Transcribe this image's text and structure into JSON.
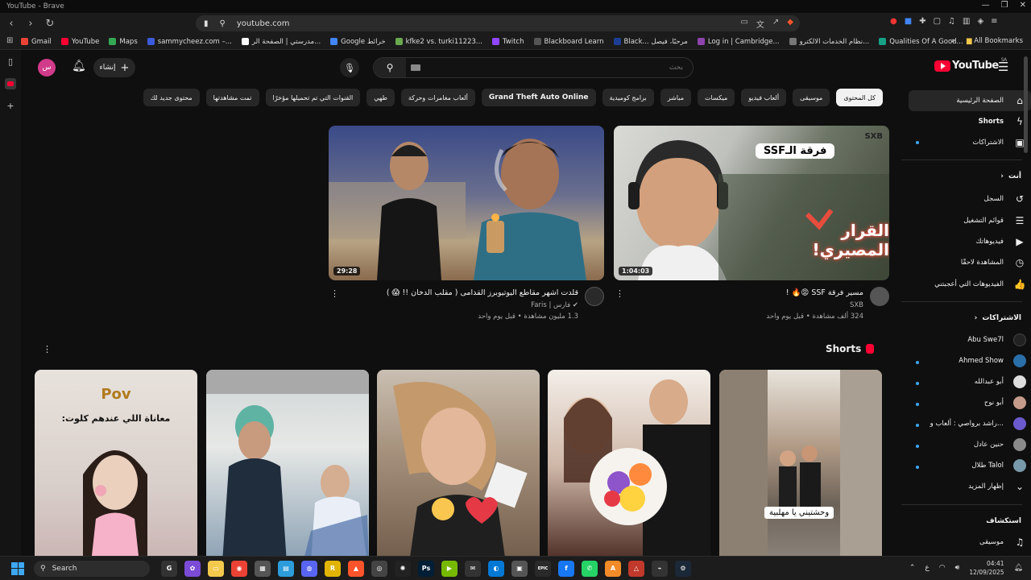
{
  "window": {
    "title": "YouTube - Brave"
  },
  "browser": {
    "url": "youtube.com",
    "bookmarks": [
      {
        "label": "Gmail",
        "color": "#ea4335"
      },
      {
        "label": "YouTube",
        "color": "#ff0033"
      },
      {
        "label": "Maps",
        "color": "#34a853"
      },
      {
        "label": "sammycheez.com –...",
        "color": "#3b5bdb"
      },
      {
        "label": "مدرستي | الصفحة الر...",
        "color": "#ffffff"
      },
      {
        "label": "Google خرائط",
        "color": "#4285f4"
      },
      {
        "label": "kfke2 vs. turki11223...",
        "color": "#6aa84f"
      },
      {
        "label": "Twitch",
        "color": "#9146ff"
      },
      {
        "label": "Blackboard Learn",
        "color": "#333333"
      },
      {
        "label": "Black... مرحبًا، فيصل",
        "color": "#1c3f94"
      },
      {
        "label": "Log in | Cambridge...",
        "color": "#8e44ad"
      },
      {
        "label": "نظام الخدمات الالكترو...",
        "color": "#777777"
      },
      {
        "label": "Qualities Of A Good...",
        "color": "#16a085"
      }
    ],
    "all_bookmarks": "All Bookmarks"
  },
  "header": {
    "avatar_initials": "س",
    "create_label": "إنشاء",
    "search_placeholder": "بحث",
    "logo_text": "YouTube",
    "logo_region": "SA"
  },
  "chips": [
    {
      "label": "كل المحتوى",
      "active": true
    },
    {
      "label": "موسيقى"
    },
    {
      "label": "ألعاب فيديو"
    },
    {
      "label": "ميكسات"
    },
    {
      "label": "مباشر"
    },
    {
      "label": "برامج كوميدية"
    },
    {
      "label": "Grand Theft Auto Online",
      "bold": true
    },
    {
      "label": "ألعاب مغامرات وحركة"
    },
    {
      "label": "طهي"
    },
    {
      "label": "القنوات التي تم تحميلها مؤخرًا"
    },
    {
      "label": "تمت مشاهدتها"
    },
    {
      "label": "محتوى جديد لك"
    }
  ],
  "videos": [
    {
      "title": "مسير فرقة SSF 😡🔥 !",
      "channel": "SXB",
      "stats": "324 ألف مشاهدة • قبل يوم واحد",
      "duration": "1:04:03",
      "thumb_text_top": "فرقة الـSSF",
      "thumb_text_bottom": "القرار المصيري!",
      "brand": "SXB",
      "avatar_color": "#555555"
    },
    {
      "title": "قلدت اشهر مقاطع اليوتيوبرز القدامى ( مقلب الدخان !! 😱 )",
      "channel": "فارس | Faris",
      "stats": "1.3 مليون مشاهدة • قبل يوم واحد",
      "duration": "29:28",
      "avatar_color": "#2a2a2a"
    }
  ],
  "shorts": {
    "title": "Shorts",
    "items": [
      {
        "color": "#6b6b6b",
        "text": "وحشتيني يا مهلبية"
      },
      {
        "color": "#b98a7a"
      },
      {
        "color": "#a58c7a"
      },
      {
        "color": "#7a96a8"
      },
      {
        "color": "#d9d2cf",
        "text_top": "Pov",
        "text_sub": "معاناة اللي عندهم كلوت:"
      }
    ]
  },
  "sidebar": {
    "main": [
      {
        "label": "الصفحة الرئيسية",
        "icon": "home-icon",
        "glyph": "⌂",
        "active": true
      },
      {
        "label": "Shorts",
        "icon": "shorts-icon",
        "glyph": "ϟ"
      },
      {
        "label": "الاشتراكات",
        "icon": "subscriptions-icon",
        "glyph": "▣",
        "dot": true
      }
    ],
    "you_header": "أنت",
    "you": [
      {
        "label": "السجل",
        "icon": "history-icon",
        "glyph": "↺"
      },
      {
        "label": "قوائم التشغيل",
        "icon": "playlists-icon",
        "glyph": "☰"
      },
      {
        "label": "فيديوهاتك",
        "icon": "your-videos-icon",
        "glyph": "▶"
      },
      {
        "label": "المشاهدة لاحقًا",
        "icon": "watch-later-icon",
        "glyph": "◷"
      },
      {
        "label": "الفيديوهات التي أعجبتني",
        "icon": "liked-icon",
        "glyph": "👍"
      }
    ],
    "subs_header": "الاشتراكات",
    "subs": [
      {
        "label": "Abu Swe7l",
        "color": "#222222"
      },
      {
        "label": "Ahmed Show",
        "color": "#2a6fa8",
        "dot": true
      },
      {
        "label": "أبو عبدالله",
        "color": "#dddddd",
        "dot": true
      },
      {
        "label": "أبو نوح",
        "color": "#c49a8a",
        "dot": true
      },
      {
        "label": "راشد برواصي : ألعاب و...",
        "color": "#6a5acd",
        "dot": true
      },
      {
        "label": "حنين عادل",
        "color": "#8a8a8a",
        "dot": true
      },
      {
        "label": "طلال Talol",
        "color": "#7799aa",
        "dot": true
      }
    ],
    "show_more": "إظهار المزيد",
    "explore_header": "استكشاف",
    "explore": [
      {
        "label": "موسيقى",
        "icon": "music-icon",
        "glyph": "♫"
      }
    ]
  },
  "taskbar": {
    "search_label": "Search",
    "apps": [
      {
        "name": "app-g",
        "color": "#333333",
        "glyph": "G"
      },
      {
        "name": "app-galaxy",
        "color": "#7b4bd6",
        "glyph": "✿"
      },
      {
        "name": "file-explorer",
        "color": "#f2c94c",
        "glyph": "▭"
      },
      {
        "name": "chrome",
        "color": "#ea4335",
        "glyph": "◉"
      },
      {
        "name": "store",
        "color": "#555555",
        "glyph": "▦"
      },
      {
        "name": "notes",
        "color": "#2d9cdb",
        "glyph": "▤"
      },
      {
        "name": "discord",
        "color": "#5865f2",
        "glyph": "◍"
      },
      {
        "name": "roblox-studio",
        "color": "#e0b400",
        "glyph": "R"
      },
      {
        "name": "brave",
        "color": "#fb542b",
        "glyph": "▲"
      },
      {
        "name": "steam-1",
        "color": "#444444",
        "glyph": "◎"
      },
      {
        "name": "steelseries",
        "color": "#222222",
        "glyph": "✺"
      },
      {
        "name": "photoshop",
        "color": "#001e36",
        "glyph": "Ps"
      },
      {
        "name": "nvidia",
        "color": "#76b900",
        "glyph": "▶"
      },
      {
        "name": "mail",
        "color": "#333333",
        "glyph": "✉"
      },
      {
        "name": "edge",
        "color": "#0078d4",
        "glyph": "◐"
      },
      {
        "name": "app-window",
        "color": "#555555",
        "glyph": "▣"
      },
      {
        "name": "epic-games",
        "color": "#2a2a2a",
        "glyph": "EPIC"
      },
      {
        "name": "facebook",
        "color": "#1877f2",
        "glyph": "f"
      },
      {
        "name": "whatsapp",
        "color": "#25d366",
        "glyph": "✆"
      },
      {
        "name": "app-orange",
        "color": "#f28c28",
        "glyph": "A"
      },
      {
        "name": "app-red",
        "color": "#c0392b",
        "glyph": "△"
      },
      {
        "name": "app-dark",
        "color": "#333333",
        "glyph": "⌁"
      },
      {
        "name": "steam-2",
        "color": "#1b2838",
        "glyph": "⚙"
      }
    ],
    "lang": "ع",
    "time": "04:41",
    "date": "12/09/2025"
  }
}
